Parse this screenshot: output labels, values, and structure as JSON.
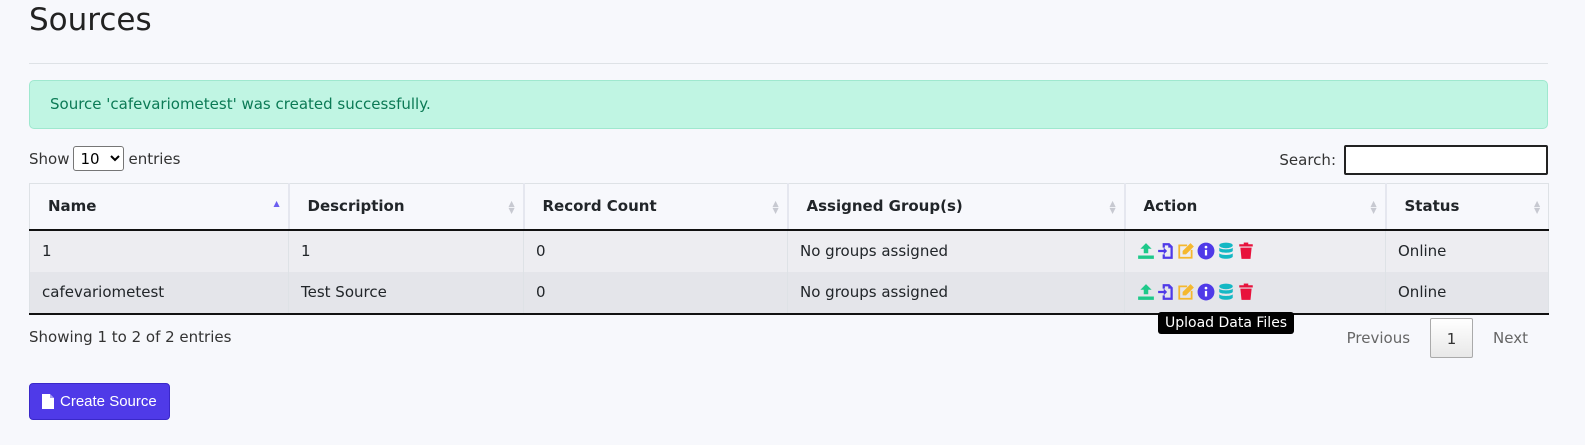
{
  "page": {
    "title": "Sources"
  },
  "alert": {
    "message": "Source 'cafevariometest' was created successfully."
  },
  "length": {
    "show_label": "Show",
    "selected": "10",
    "entries_label": "entries"
  },
  "search": {
    "label": "Search:",
    "value": ""
  },
  "table": {
    "headers": [
      "Name",
      "Description",
      "Record Count",
      "Assigned Group(s)",
      "Action",
      "Status"
    ],
    "rows": [
      {
        "name": "1",
        "description": "1",
        "record_count": "0",
        "groups": "No groups assigned",
        "status": "Online"
      },
      {
        "name": "cafevariometest",
        "description": "Test Source",
        "record_count": "0",
        "groups": "No groups assigned",
        "status": "Online"
      }
    ]
  },
  "tooltip": {
    "text": "Upload Data Files"
  },
  "info": {
    "text": "Showing 1 to 2 of 2 entries"
  },
  "pagination": {
    "previous": "Previous",
    "current": "1",
    "next": "Next"
  },
  "create_button": {
    "label": "Create Source"
  },
  "icons": {
    "upload": {
      "name": "upload-icon",
      "color": "#1ec98a"
    },
    "import": {
      "name": "file-import-icon",
      "color": "#4f3ae8"
    },
    "edit": {
      "name": "edit-icon",
      "color": "#f5b82e"
    },
    "info": {
      "name": "info-icon",
      "color": "#4f3ae8"
    },
    "database": {
      "name": "database-icon",
      "color": "#14b8c4"
    },
    "delete": {
      "name": "trash-icon",
      "color": "#e8123c"
    }
  },
  "colors": {
    "alert_bg": "#c0f5e3",
    "alert_text": "#0b7a55",
    "primary": "#4f3ae8"
  }
}
